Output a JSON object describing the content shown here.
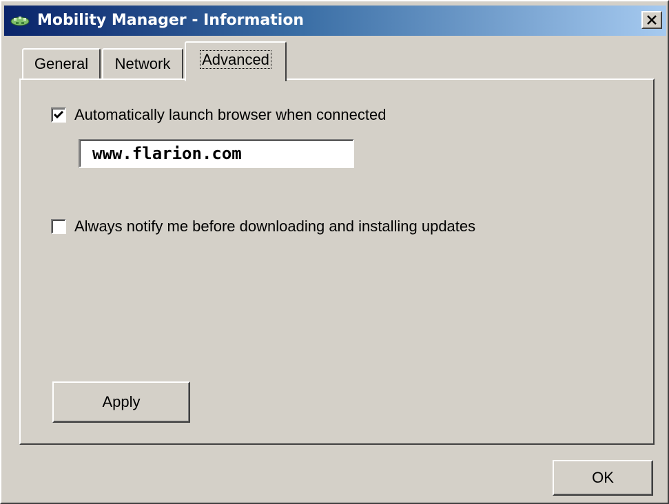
{
  "window": {
    "title": "Mobility Manager - Information",
    "close_label": "×"
  },
  "tabs": [
    {
      "label": "General"
    },
    {
      "label": "Network"
    },
    {
      "label": "Advanced",
      "selected": true
    }
  ],
  "advanced": {
    "auto_launch": {
      "label": "Automatically launch browser when connected",
      "checked": true
    },
    "url": {
      "value": "www.flarion.com"
    },
    "notify_updates": {
      "label": "Always notify me before downloading and installing updates",
      "checked": false
    },
    "apply_label": "Apply"
  },
  "footer": {
    "ok_label": "OK"
  },
  "icons": {
    "title": "app-icon",
    "close": "close-icon",
    "check": "check-icon"
  },
  "colors": {
    "titlebar_start": "#0a246a",
    "titlebar_end": "#a6caf0",
    "face": "#d4d0c8"
  }
}
